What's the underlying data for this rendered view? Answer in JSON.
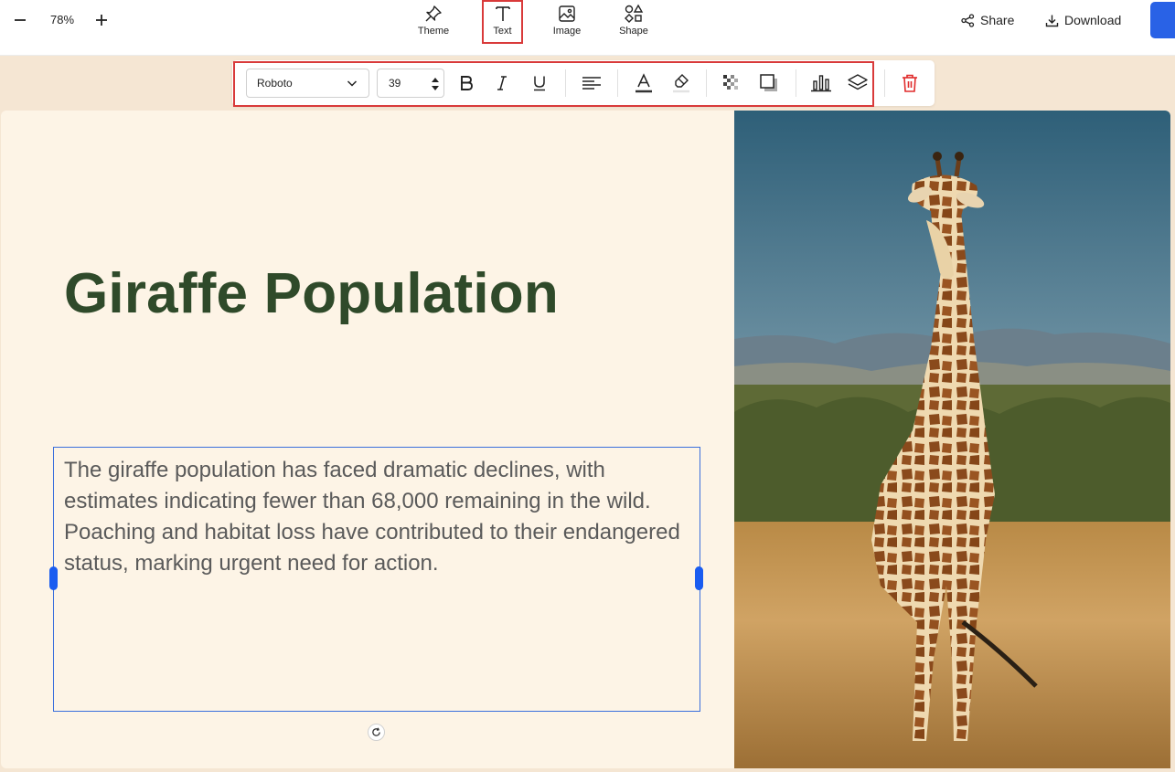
{
  "topbar": {
    "zoom_value": "78%",
    "tools": [
      {
        "label": "Theme",
        "icon": "pin-icon"
      },
      {
        "label": "Text",
        "icon": "text-icon"
      },
      {
        "label": "Image",
        "icon": "image-icon"
      },
      {
        "label": "Shape",
        "icon": "shapes-icon"
      }
    ],
    "share_label": "Share",
    "download_label": "Download"
  },
  "toolbar": {
    "font_name": "Roboto",
    "font_size": "39",
    "icons": [
      "bold-icon",
      "italic-icon",
      "underline-icon",
      "align-left-icon",
      "text-color-icon",
      "highlight-icon",
      "transparency-icon",
      "shadow-icon",
      "chart-icon",
      "layers-icon",
      "delete-icon"
    ]
  },
  "slide": {
    "title": "Giraffe Population",
    "body": "The giraffe population has faced dramatic declines, with estimates indicating fewer than 68,000 remaining in the wild. Poaching and habitat loss have contributed to their endangered status, marking urgent need for action.",
    "image_subject": "giraffe-photo"
  },
  "colors": {
    "title": "#2f4a2a",
    "body_text": "#5a5a5a",
    "slide_bg": "#fdf4e6",
    "canvas_bg": "#f5e6d3",
    "selection": "#1a5cf0",
    "highlight_box": "#d93a3a",
    "delete": "#e02b2b",
    "primary_button": "#2962e6"
  }
}
